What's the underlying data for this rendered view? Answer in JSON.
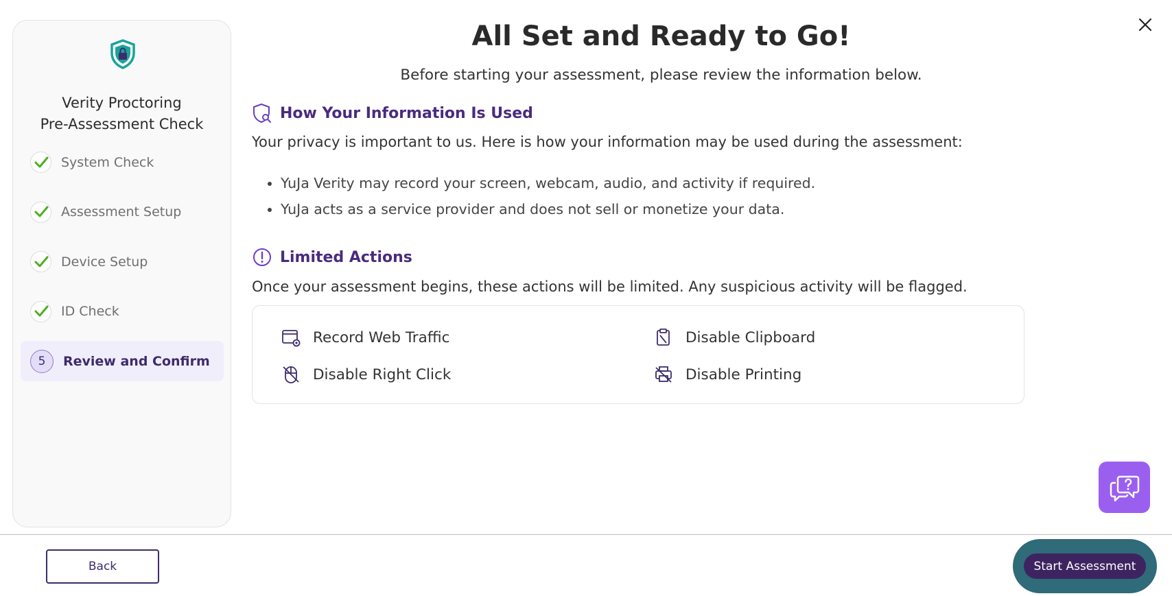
{
  "sidebar": {
    "title_line1": "Verity Proctoring",
    "title_line2": "Pre-Assessment Check",
    "steps": [
      {
        "label": "System Check",
        "status": "done"
      },
      {
        "label": "Assessment Setup",
        "status": "done"
      },
      {
        "label": "Device Setup",
        "status": "done"
      },
      {
        "label": "ID Check",
        "status": "done"
      },
      {
        "label": "Review and Confirm",
        "status": "active",
        "number": "5"
      }
    ]
  },
  "header": {
    "title": "All Set and Ready to Go!",
    "subtitle": "Before starting your assessment, please review the information below."
  },
  "info_section": {
    "heading": "How Your Information Is Used",
    "intro": "Your privacy is important to us. Here is how your information may be used during the assessment:",
    "bullets": [
      "YuJa Verity may record your screen, webcam, audio, and activity if required.",
      "YuJa acts as a service provider and does not sell or monetize your data."
    ]
  },
  "limited_section": {
    "heading": "Limited Actions",
    "intro": "Once your assessment begins, these actions will be limited. Any suspicious activity will be flagged.",
    "actions": [
      {
        "label": "Record Web Traffic",
        "icon": "web-traffic-icon"
      },
      {
        "label": "Disable Clipboard",
        "icon": "clipboard-off-icon"
      },
      {
        "label": "Disable Right Click",
        "icon": "mouse-off-icon"
      },
      {
        "label": "Disable Printing",
        "icon": "printer-off-icon"
      }
    ]
  },
  "footer": {
    "back_label": "Back",
    "start_label": "Start Assessment"
  },
  "colors": {
    "brand_purple": "#4a2b7d",
    "check_green": "#4caf1f",
    "shield_teal": "#19a39a",
    "help_purple": "#9b5ff0",
    "start_ring": "#2f6b78"
  }
}
